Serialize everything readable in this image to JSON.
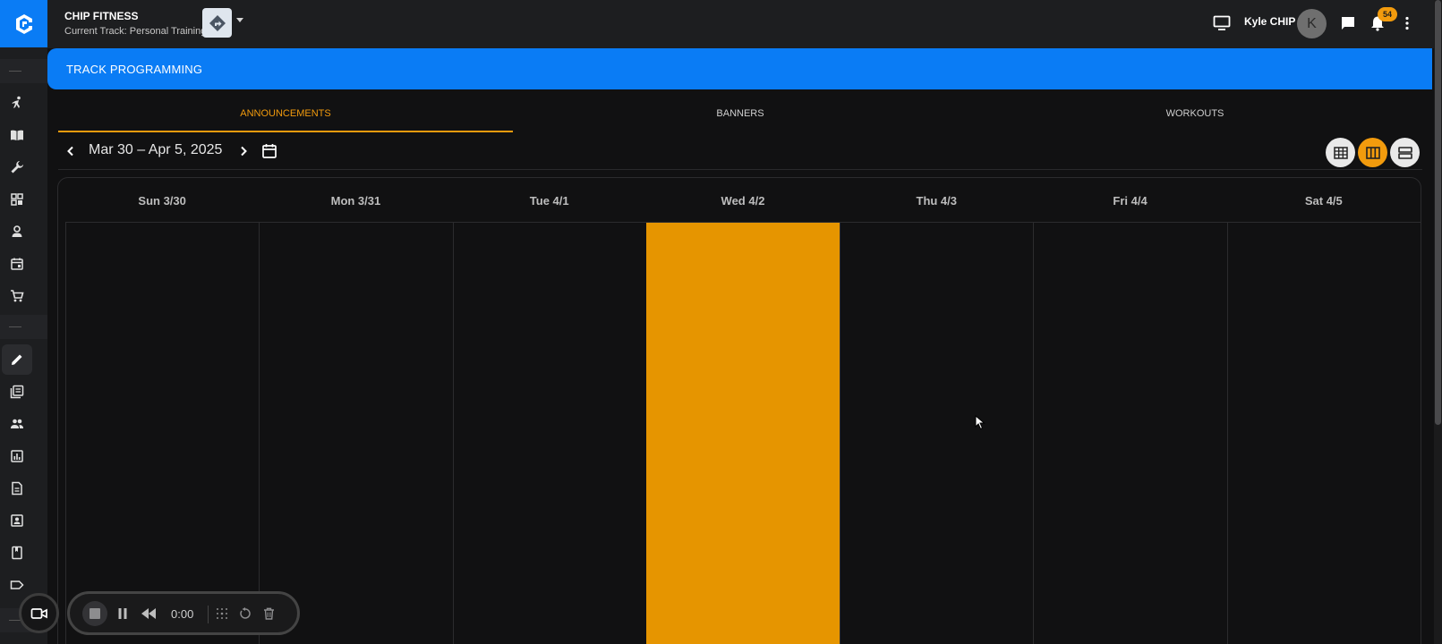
{
  "header": {
    "org_name": "CHIP FITNESS",
    "current_track": "Current Track: Personal Training",
    "user_name": "Kyle CHIP",
    "avatar_initial": "K",
    "notification_count": "54"
  },
  "banner": {
    "title": "TRACK PROGRAMMING"
  },
  "tabs": [
    {
      "label": "ANNOUNCEMENTS",
      "active": true
    },
    {
      "label": "BANNERS",
      "active": false
    },
    {
      "label": "WORKOUTS",
      "active": false
    }
  ],
  "date_nav": {
    "range": "Mar 30 – Apr 5, 2025",
    "active_view": "week"
  },
  "calendar": {
    "days": [
      "Sun 3/30",
      "Mon 3/31",
      "Tue 4/1",
      "Wed 4/2",
      "Thu 4/3",
      "Fri 4/4",
      "Sat 4/5"
    ],
    "today_index": 3
  },
  "recorder": {
    "time": "0:00"
  },
  "colors": {
    "brand_blue": "#0a7cf5",
    "accent_orange": "#f29b0d",
    "today_fill": "#e69500"
  }
}
